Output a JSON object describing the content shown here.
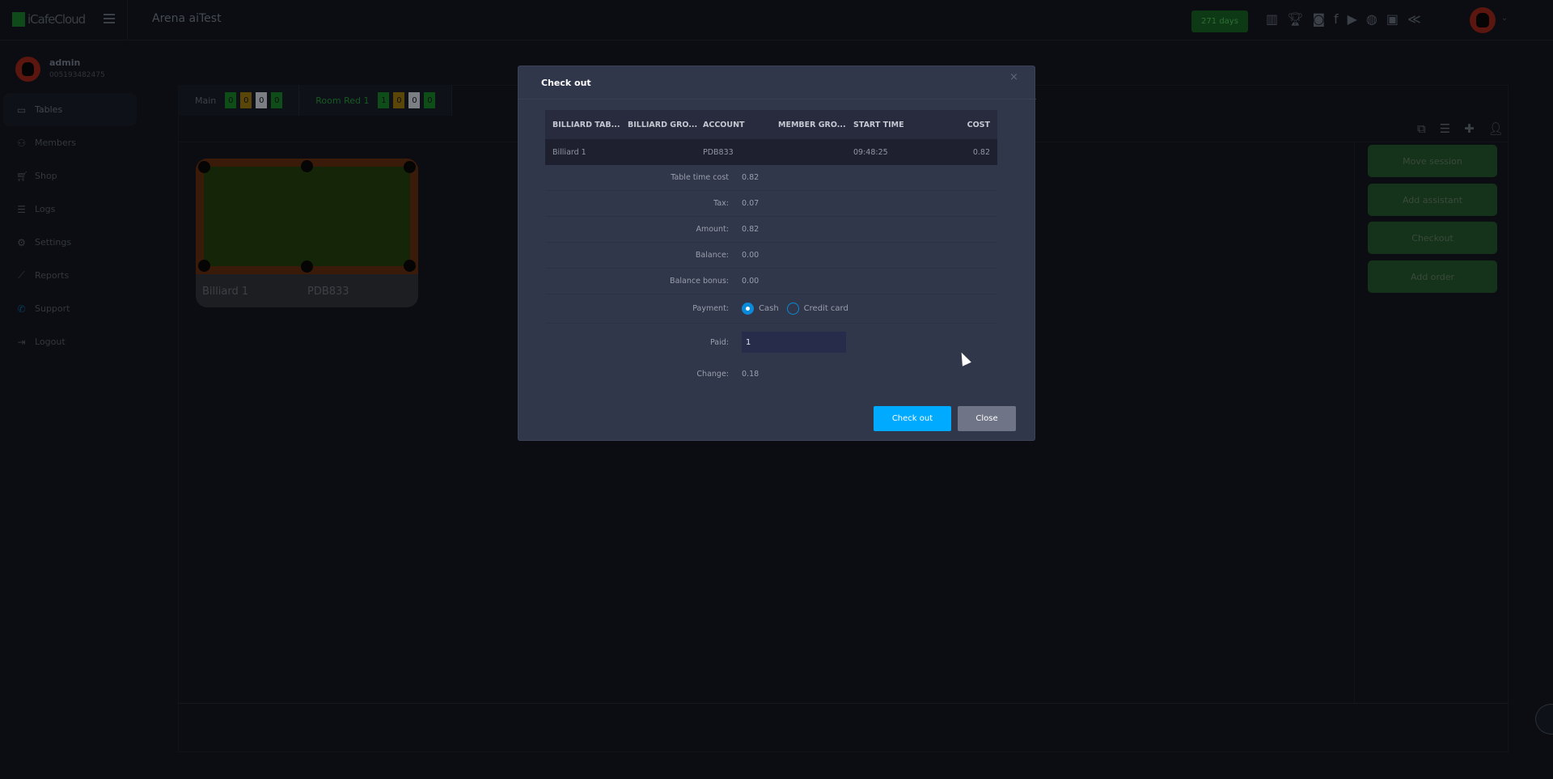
{
  "app": {
    "logo": "iCafeCloud",
    "title": "Arena aiTest",
    "days_badge": "271 days"
  },
  "header_icons": [
    "ranking-icon",
    "trophy-icon",
    "discord-icon",
    "facebook-icon",
    "youtube-icon",
    "globe-icon",
    "icafe-icon",
    "brand-icon"
  ],
  "user": {
    "name": "admin",
    "id": "005193482475"
  },
  "sidebar": {
    "items": [
      {
        "label": "Tables",
        "icon": "monitor-icon",
        "active": true
      },
      {
        "label": "Members",
        "icon": "members-icon"
      },
      {
        "label": "Shop",
        "icon": "cart-icon"
      },
      {
        "label": "Logs",
        "icon": "list-icon"
      },
      {
        "label": "Settings",
        "icon": "gear-icon"
      },
      {
        "label": "Reports",
        "icon": "chart-icon"
      },
      {
        "label": "Support",
        "icon": "phone-icon"
      },
      {
        "label": "Logout",
        "icon": "logout-icon"
      }
    ]
  },
  "rooms": [
    {
      "name": "Main",
      "counts": [
        "0",
        "0",
        "0",
        "0"
      ]
    },
    {
      "name": "Room Red 1",
      "counts": [
        "1",
        "0",
        "0",
        "0"
      ]
    }
  ],
  "count_colors": [
    "#0f4d18",
    "#5a4608",
    "#7b7e82",
    "#0f4d18"
  ],
  "table_card": {
    "name": "Billiard 1",
    "account": "PDB833"
  },
  "actions": [
    "Move session",
    "Add assistant",
    "Checkout",
    "Add order"
  ],
  "modal": {
    "title": "Check out",
    "columns": [
      "BILLIARD TAB...",
      "BILLIARD GRO...",
      "ACCOUNT",
      "MEMBER GRO...",
      "START TIME",
      "COST"
    ],
    "rows": [
      [
        "Billiard 1",
        "",
        "PDB833",
        "",
        "09:48:25",
        "0.82"
      ]
    ],
    "summary": [
      {
        "label": "Table time cost",
        "value": "0.82"
      },
      {
        "label": "Tax:",
        "value": "0.07"
      },
      {
        "label": "Amount:",
        "value": "0.82"
      },
      {
        "label": "Balance:",
        "value": "0.00"
      },
      {
        "label": "Balance bonus:",
        "value": "0.00"
      }
    ],
    "payment": {
      "label": "Payment:",
      "options": [
        "Cash",
        "Credit card"
      ],
      "selected": "Cash"
    },
    "paid": {
      "label": "Paid:",
      "value": "1"
    },
    "change": {
      "label": "Change:",
      "value": "0.18"
    },
    "checkout_label": "Check out",
    "close_label": "Close"
  }
}
